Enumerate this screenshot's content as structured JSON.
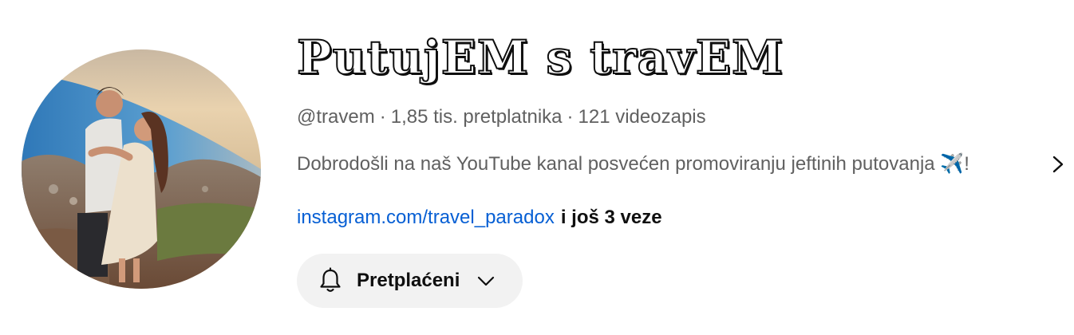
{
  "channel": {
    "name": "PutujEM s travEM",
    "handle": "@travem",
    "subscribers": "1,85 tis. pretplatnika",
    "videos": "121 videozapis",
    "separator": "·",
    "description": "Dobrodošli na naš YouTube kanal posvećen promoviranju jeftinih putovanja ✈️!",
    "link": "instagram.com/travel_paradox",
    "more_links": "i još 3 veze"
  },
  "subscribe_button": {
    "label": "Pretplaćeni",
    "icon": "bell-icon",
    "dropdown_icon": "chevron-down-icon"
  },
  "colors": {
    "secondary_text": "#606060",
    "link": "#065fd4",
    "button_bg": "#f2f2f2"
  }
}
